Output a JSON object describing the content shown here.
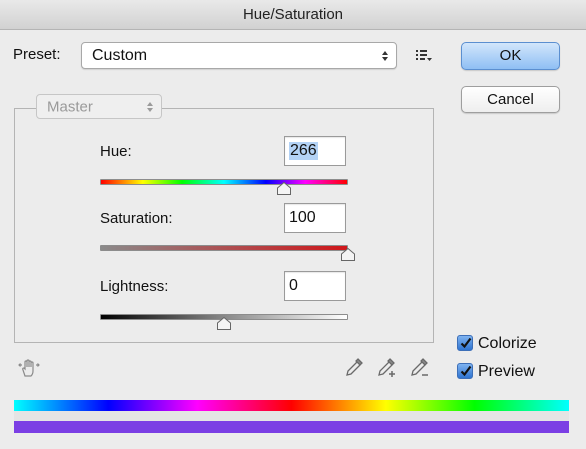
{
  "window": {
    "title": "Hue/Saturation"
  },
  "preset": {
    "label": "Preset:",
    "value": "Custom"
  },
  "buttons": {
    "ok": "OK",
    "cancel": "Cancel"
  },
  "channel": {
    "value": "Master"
  },
  "hue": {
    "label": "Hue:",
    "value": "266",
    "slider_fraction": 0.74
  },
  "saturation": {
    "label": "Saturation:",
    "value": "100",
    "slider_fraction": 1.0
  },
  "lightness": {
    "label": "Lightness:",
    "value": "0",
    "slider_fraction": 0.5
  },
  "options": {
    "colorize": {
      "label": "Colorize",
      "checked": true
    },
    "preview": {
      "label": "Preview",
      "checked": true
    }
  },
  "colors": {
    "ok_button": "#8fbff4",
    "colorize_result": "#7b3fe4",
    "saturation_red": "#d0161a",
    "selection_highlight": "#b3d2f5"
  },
  "icons": [
    "preset-options-icon",
    "hand-adjust-icon",
    "eyedropper-icon",
    "eyedropper-plus-icon",
    "eyedropper-minus-icon",
    "checkmark-icon"
  ]
}
